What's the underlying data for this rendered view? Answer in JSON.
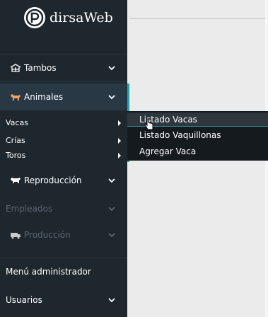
{
  "brand": {
    "name": "dirsaWeb"
  },
  "sidebar": {
    "items": [
      {
        "label": "Tambos",
        "icon": "barn-icon"
      },
      {
        "label": "Animales",
        "icon": "cow-icon"
      },
      {
        "label": "Reproducción",
        "icon": "bull-icon"
      },
      {
        "label": "Empleados",
        "icon": ""
      },
      {
        "label": "Producción",
        "icon": "milk-truck-icon"
      }
    ],
    "submenu": [
      {
        "label": "Vacas"
      },
      {
        "label": "Crías"
      },
      {
        "label": "Toros"
      }
    ],
    "admin_label": "Menú administrador",
    "users_label": "Usuarios"
  },
  "flyout": {
    "items": [
      {
        "label": "Listado Vacas"
      },
      {
        "label": "Listado Vaquillonas"
      },
      {
        "label": "Agregar Vaca"
      }
    ]
  },
  "colors": {
    "sidebar": "#1f272e",
    "accent": "#1aa6a6",
    "content": "#ebebeb"
  }
}
